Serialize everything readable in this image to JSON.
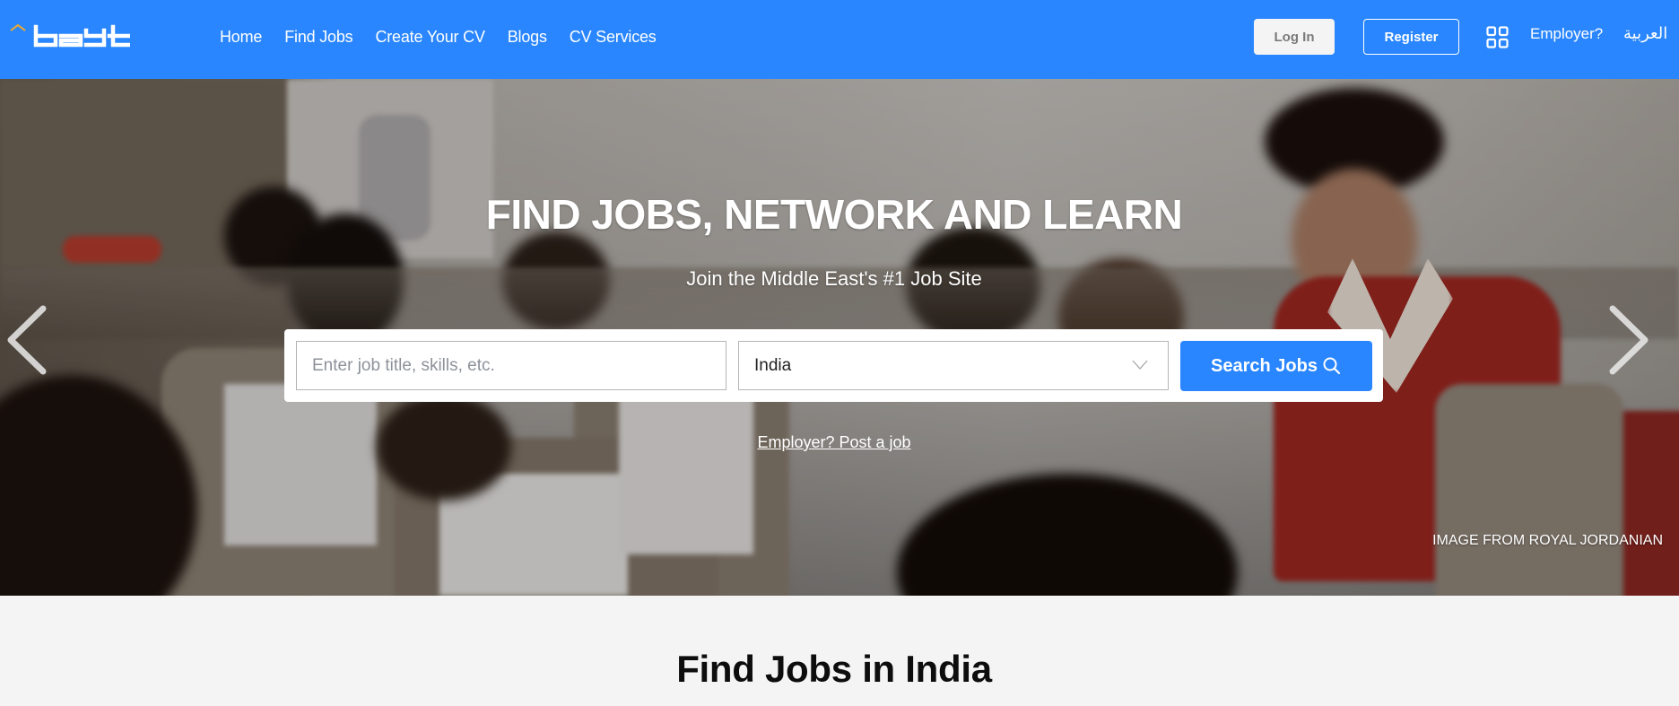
{
  "header": {
    "logo_text": "bayt",
    "nav": [
      {
        "label": "Home"
      },
      {
        "label": "Find Jobs"
      },
      {
        "label": "Create Your CV"
      },
      {
        "label": "Blogs"
      },
      {
        "label": "CV Services"
      }
    ],
    "login_label": "Log In",
    "register_label": "Register",
    "apps_icon": "grid-icon",
    "employer_label": "Employer?",
    "language_label": "العربية",
    "brand_color": "#2986fe",
    "logo_accent_color": "#e3a63d"
  },
  "hero": {
    "title": "FIND JOBS, NETWORK AND LEARN",
    "subtitle": "Join the Middle East's #1 Job Site",
    "search": {
      "keyword_placeholder": "Enter job title, skills, etc.",
      "keyword_value": "",
      "country_value": "India",
      "button_label": "Search Jobs",
      "button_icon": "search-icon"
    },
    "post_job_label": "Employer? Post a job",
    "prev_icon": "chevron-left-icon",
    "next_icon": "chevron-right-icon",
    "image_credit": "IMAGE FROM ROYAL JORDANIAN"
  },
  "section": {
    "title": "Find Jobs in India"
  }
}
